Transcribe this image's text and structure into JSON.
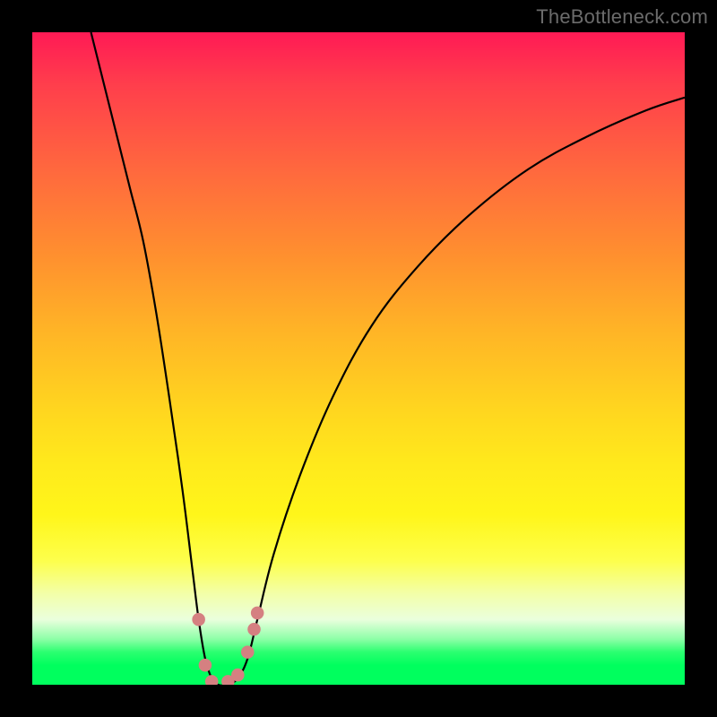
{
  "watermark": "TheBottleneck.com",
  "chart_data": {
    "type": "line",
    "title": "",
    "xlabel": "",
    "ylabel": "",
    "xlim": [
      0,
      100
    ],
    "ylim": [
      0,
      100
    ],
    "grid": false,
    "curve_description": "V-shaped bottleneck curve with minimum near x≈28; descends steeply from top-left, bottoms out to ~0, then rises with diminishing slope toward top-right.",
    "curve_points": [
      {
        "x": 9,
        "y": 100
      },
      {
        "x": 11,
        "y": 92
      },
      {
        "x": 13,
        "y": 84
      },
      {
        "x": 15,
        "y": 76
      },
      {
        "x": 17,
        "y": 68
      },
      {
        "x": 19,
        "y": 57
      },
      {
        "x": 21,
        "y": 44
      },
      {
        "x": 23,
        "y": 30
      },
      {
        "x": 24.5,
        "y": 18
      },
      {
        "x": 25.5,
        "y": 10
      },
      {
        "x": 26.5,
        "y": 4
      },
      {
        "x": 27.5,
        "y": 1
      },
      {
        "x": 28.5,
        "y": 0
      },
      {
        "x": 30,
        "y": 0
      },
      {
        "x": 31.5,
        "y": 1
      },
      {
        "x": 33,
        "y": 4
      },
      {
        "x": 34.5,
        "y": 10
      },
      {
        "x": 37,
        "y": 20
      },
      {
        "x": 41,
        "y": 32
      },
      {
        "x": 46,
        "y": 44
      },
      {
        "x": 52,
        "y": 55
      },
      {
        "x": 59,
        "y": 64
      },
      {
        "x": 67,
        "y": 72
      },
      {
        "x": 76,
        "y": 79
      },
      {
        "x": 85,
        "y": 84
      },
      {
        "x": 94,
        "y": 88
      },
      {
        "x": 100,
        "y": 90
      }
    ],
    "markers": [
      {
        "x": 25.5,
        "y": 10
      },
      {
        "x": 26.5,
        "y": 3
      },
      {
        "x": 27.5,
        "y": 0.5
      },
      {
        "x": 30.0,
        "y": 0.5
      },
      {
        "x": 31.5,
        "y": 1.5
      },
      {
        "x": 33.0,
        "y": 5
      },
      {
        "x": 34.0,
        "y": 8.5
      },
      {
        "x": 34.5,
        "y": 11
      }
    ],
    "marker_radius_pct": 1.0
  }
}
